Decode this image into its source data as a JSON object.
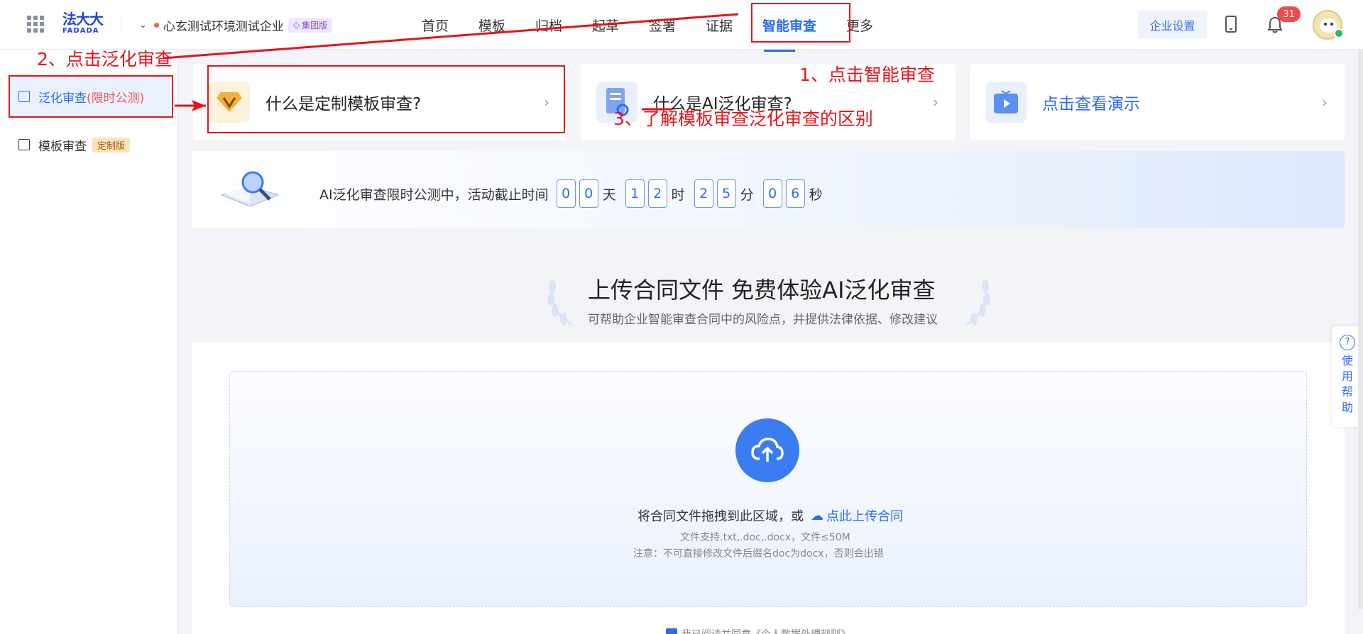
{
  "header": {
    "logo_cn": "法大大",
    "logo_en": "FADADA",
    "company_name": "心玄测试环境测试企业",
    "plan_badge": "集团版",
    "nav": [
      "首页",
      "模板",
      "归档",
      "起草",
      "签署",
      "证据",
      "智能审查",
      "更多"
    ],
    "active_nav": "智能审查",
    "enterprise_settings": "企业设置",
    "notification_count": "31"
  },
  "sidebar": {
    "items": [
      {
        "label": "泛化审查",
        "suffix": "(限时公测)",
        "active": true
      },
      {
        "label": "模板审查",
        "tag": "定制版",
        "active": false
      }
    ]
  },
  "cards": [
    {
      "title": "什么是定制模板审查?"
    },
    {
      "title": "什么是AI泛化审查?"
    },
    {
      "title": "点击查看演示"
    }
  ],
  "banner": {
    "text": "AI泛化审查限时公测中，活动截止时间",
    "countdown": {
      "days": [
        "0",
        "0"
      ],
      "day_unit": "天",
      "hours": [
        "1",
        "2"
      ],
      "hour_unit": "时",
      "minutes": [
        "2",
        "5"
      ],
      "minute_unit": "分",
      "seconds": [
        "0",
        "6"
      ],
      "second_unit": "秒"
    }
  },
  "upload": {
    "title": "上传合同文件 免费体验AI泛化审查",
    "subtitle": "可帮助企业智能审查合同中的风险点，并提供法律依据、修改建议",
    "drop_text": "将合同文件拖拽到此区域，或",
    "drop_link": "点此上传合同",
    "note_formats": "文件支持.txt,.doc,.docx，文件≤50M",
    "note_warning": "注意：不可直接修改文件后缀名doc为docx，否则会出错",
    "agree_text": "我已阅读并同意《个人数据处理规则》"
  },
  "help": {
    "label_chars": [
      "使",
      "用",
      "帮",
      "助"
    ],
    "icon": "?"
  },
  "annotations": {
    "step1": "1、点击智能审查",
    "step2": "2、点击泛化审查",
    "step3": "3、了解模板审查泛化审查的区别",
    "color": "#e5141b"
  },
  "colors": {
    "accent": "#2b6cf0",
    "annotation": "#e5141b",
    "badge": "#f0494e"
  }
}
